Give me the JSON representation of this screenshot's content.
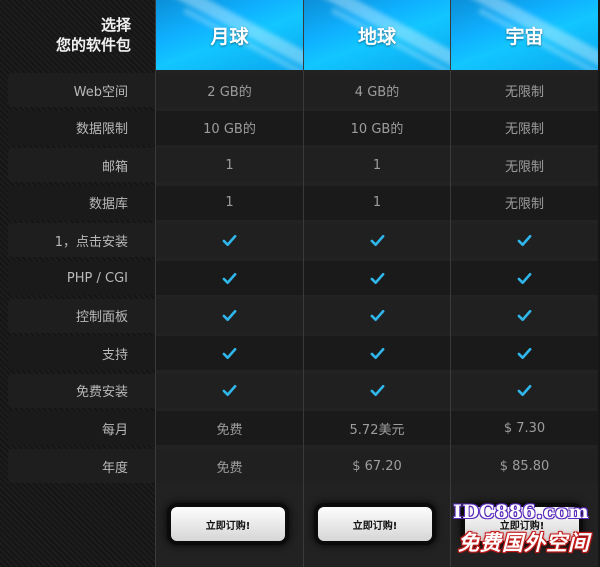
{
  "header": {
    "title_line1": "选择",
    "title_line2": "您的软件包"
  },
  "plans": [
    {
      "name": "月球",
      "order_label": "立即订购!"
    },
    {
      "name": "地球",
      "order_label": "立即订购!"
    },
    {
      "name": "宇宙",
      "order_label": "立即订购!"
    }
  ],
  "rows": [
    {
      "label": "Web空间",
      "values": [
        "2 GB的",
        "4 GB的",
        "无限制"
      ]
    },
    {
      "label": "数据限制",
      "values": [
        "10 GB的",
        "10 GB的",
        "无限制"
      ]
    },
    {
      "label": "邮箱",
      "values": [
        "1",
        "1",
        "无限制"
      ]
    },
    {
      "label": "数据库",
      "values": [
        "1",
        "1",
        "无限制"
      ]
    },
    {
      "label": "1，点击安装",
      "values": [
        "check",
        "check",
        "check"
      ]
    },
    {
      "label": "PHP / CGI",
      "values": [
        "check",
        "check",
        "check"
      ]
    },
    {
      "label": "控制面板",
      "values": [
        "check",
        "check",
        "check"
      ]
    },
    {
      "label": "支持",
      "values": [
        "check",
        "check",
        "check"
      ]
    },
    {
      "label": "免费安装",
      "values": [
        "check",
        "check",
        "check"
      ]
    },
    {
      "label": "每月",
      "values": [
        "免费",
        "5.72美元",
        "$ 7.30"
      ]
    },
    {
      "label": "年度",
      "values": [
        "免费",
        "$ 67.20",
        "$ 85.80"
      ]
    }
  ],
  "icons": {
    "included": "check-icon"
  },
  "colors": {
    "accent": "#12b7ff",
    "check": "#2fb6ea",
    "watermark_blue": "#5a2bbd",
    "watermark_red": "#c21b1b"
  },
  "watermark": {
    "line1": "IDC886.com",
    "line2": "免费国外空间"
  }
}
